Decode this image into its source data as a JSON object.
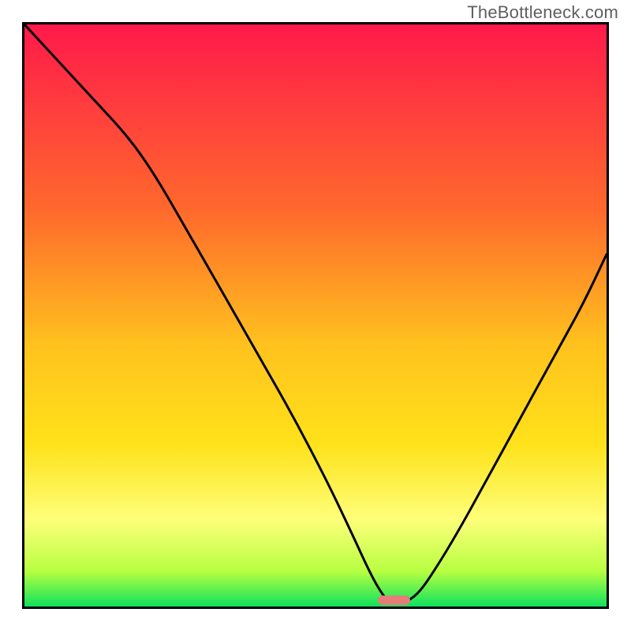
{
  "watermark_text": "TheBottleneck.com",
  "colors": {
    "red": "#ff1a4b",
    "orange": "#ff8a1e",
    "yellow": "#ffe21a",
    "lemon": "#feff7a",
    "lime": "#b7ff42",
    "green": "#0fe25d",
    "curve": "#000000",
    "marker": "#e67c78",
    "border": "#000000"
  },
  "gradient_stops": [
    {
      "pos": 0.0,
      "color": "#ff1a4b"
    },
    {
      "pos": 0.32,
      "color": "#ff6a2d"
    },
    {
      "pos": 0.55,
      "color": "#ffc21e"
    },
    {
      "pos": 0.72,
      "color": "#ffe21a"
    },
    {
      "pos": 0.85,
      "color": "#feff7a"
    },
    {
      "pos": 0.94,
      "color": "#b7ff42"
    },
    {
      "pos": 1.0,
      "color": "#0fe25d"
    }
  ],
  "marker": {
    "x_frac": 0.635,
    "y_frac": 0.989,
    "w_frac": 0.055,
    "h_frac": 0.017
  },
  "chart_data": {
    "type": "line",
    "title": "",
    "xlabel": "",
    "ylabel": "",
    "xlim": [
      0,
      1
    ],
    "ylim": [
      0,
      1
    ],
    "curve_points_xy": [
      [
        0.0,
        1.0
      ],
      [
        0.06,
        0.935
      ],
      [
        0.12,
        0.87
      ],
      [
        0.18,
        0.805
      ],
      [
        0.225,
        0.74
      ],
      [
        0.28,
        0.645
      ],
      [
        0.34,
        0.54
      ],
      [
        0.4,
        0.435
      ],
      [
        0.46,
        0.33
      ],
      [
        0.52,
        0.215
      ],
      [
        0.565,
        0.12
      ],
      [
        0.595,
        0.055
      ],
      [
        0.615,
        0.02
      ],
      [
        0.63,
        0.005
      ],
      [
        0.65,
        0.005
      ],
      [
        0.675,
        0.02
      ],
      [
        0.7,
        0.055
      ],
      [
        0.74,
        0.12
      ],
      [
        0.79,
        0.21
      ],
      [
        0.85,
        0.32
      ],
      [
        0.91,
        0.43
      ],
      [
        0.96,
        0.52
      ],
      [
        1.0,
        0.605
      ]
    ],
    "background_gradient": "vertical red→orange→yellow→green",
    "optimum_zone_x": [
      0.61,
      0.665
    ],
    "note": "x and y are normalized 0–1; y=0 is bottom (inverted for SVG)."
  }
}
